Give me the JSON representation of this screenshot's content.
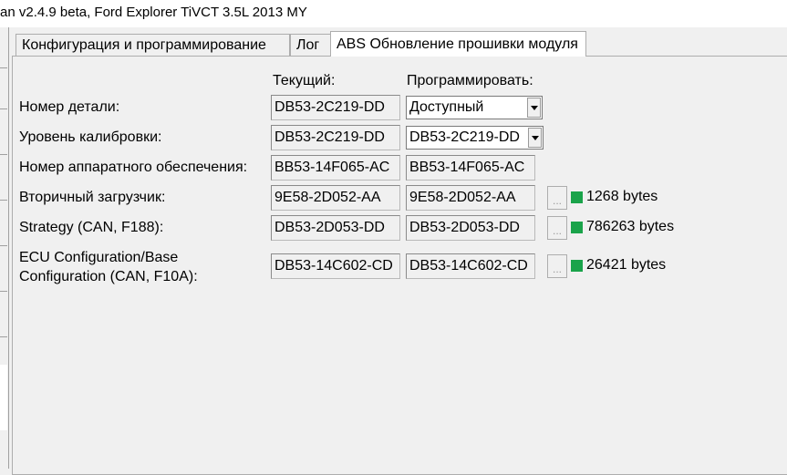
{
  "window": {
    "title": "an v2.4.9 beta, Ford Explorer TiVCT 3.5L 2013 MY"
  },
  "tabs": [
    {
      "label": "Конфигурация и программирование"
    },
    {
      "label": "Лог"
    },
    {
      "label": "ABS Обновление прошивки модуля"
    }
  ],
  "headers": {
    "current": "Текущий:",
    "program": "Программировать:"
  },
  "rows": [
    {
      "label": "Номер детали:",
      "current": "DB53-2C219-DD",
      "program": "Доступный",
      "program_type": "combo"
    },
    {
      "label": "Уровень калибровки:",
      "current": "DB53-2C219-DD",
      "program": "DB53-2C219-DD",
      "program_type": "combo"
    },
    {
      "label": "Номер аппаратного обеспечения:",
      "current": "BB53-14F065-AC",
      "program": "BB53-14F065-AC",
      "program_type": "field"
    },
    {
      "label": "Вторичный загрузчик:",
      "current": "9E58-2D052-AA",
      "program": "9E58-2D052-AA",
      "program_type": "field",
      "browse": "...",
      "status_color": "#1aa34a",
      "bytes": "1268 bytes"
    },
    {
      "label": "Strategy (CAN, F188):",
      "current": "DB53-2D053-DD",
      "program": "DB53-2D053-DD",
      "program_type": "field",
      "browse": "...",
      "status_color": "#1aa34a",
      "bytes": "786263 bytes"
    },
    {
      "label_line1": "ECU Configuration/Base",
      "label_line2": "Configuration (CAN, F10A):",
      "current": "DB53-14C602-CD",
      "program": "DB53-14C602-CD",
      "program_type": "field",
      "browse": "...",
      "status_color": "#1aa34a",
      "bytes": "26421 bytes"
    }
  ]
}
